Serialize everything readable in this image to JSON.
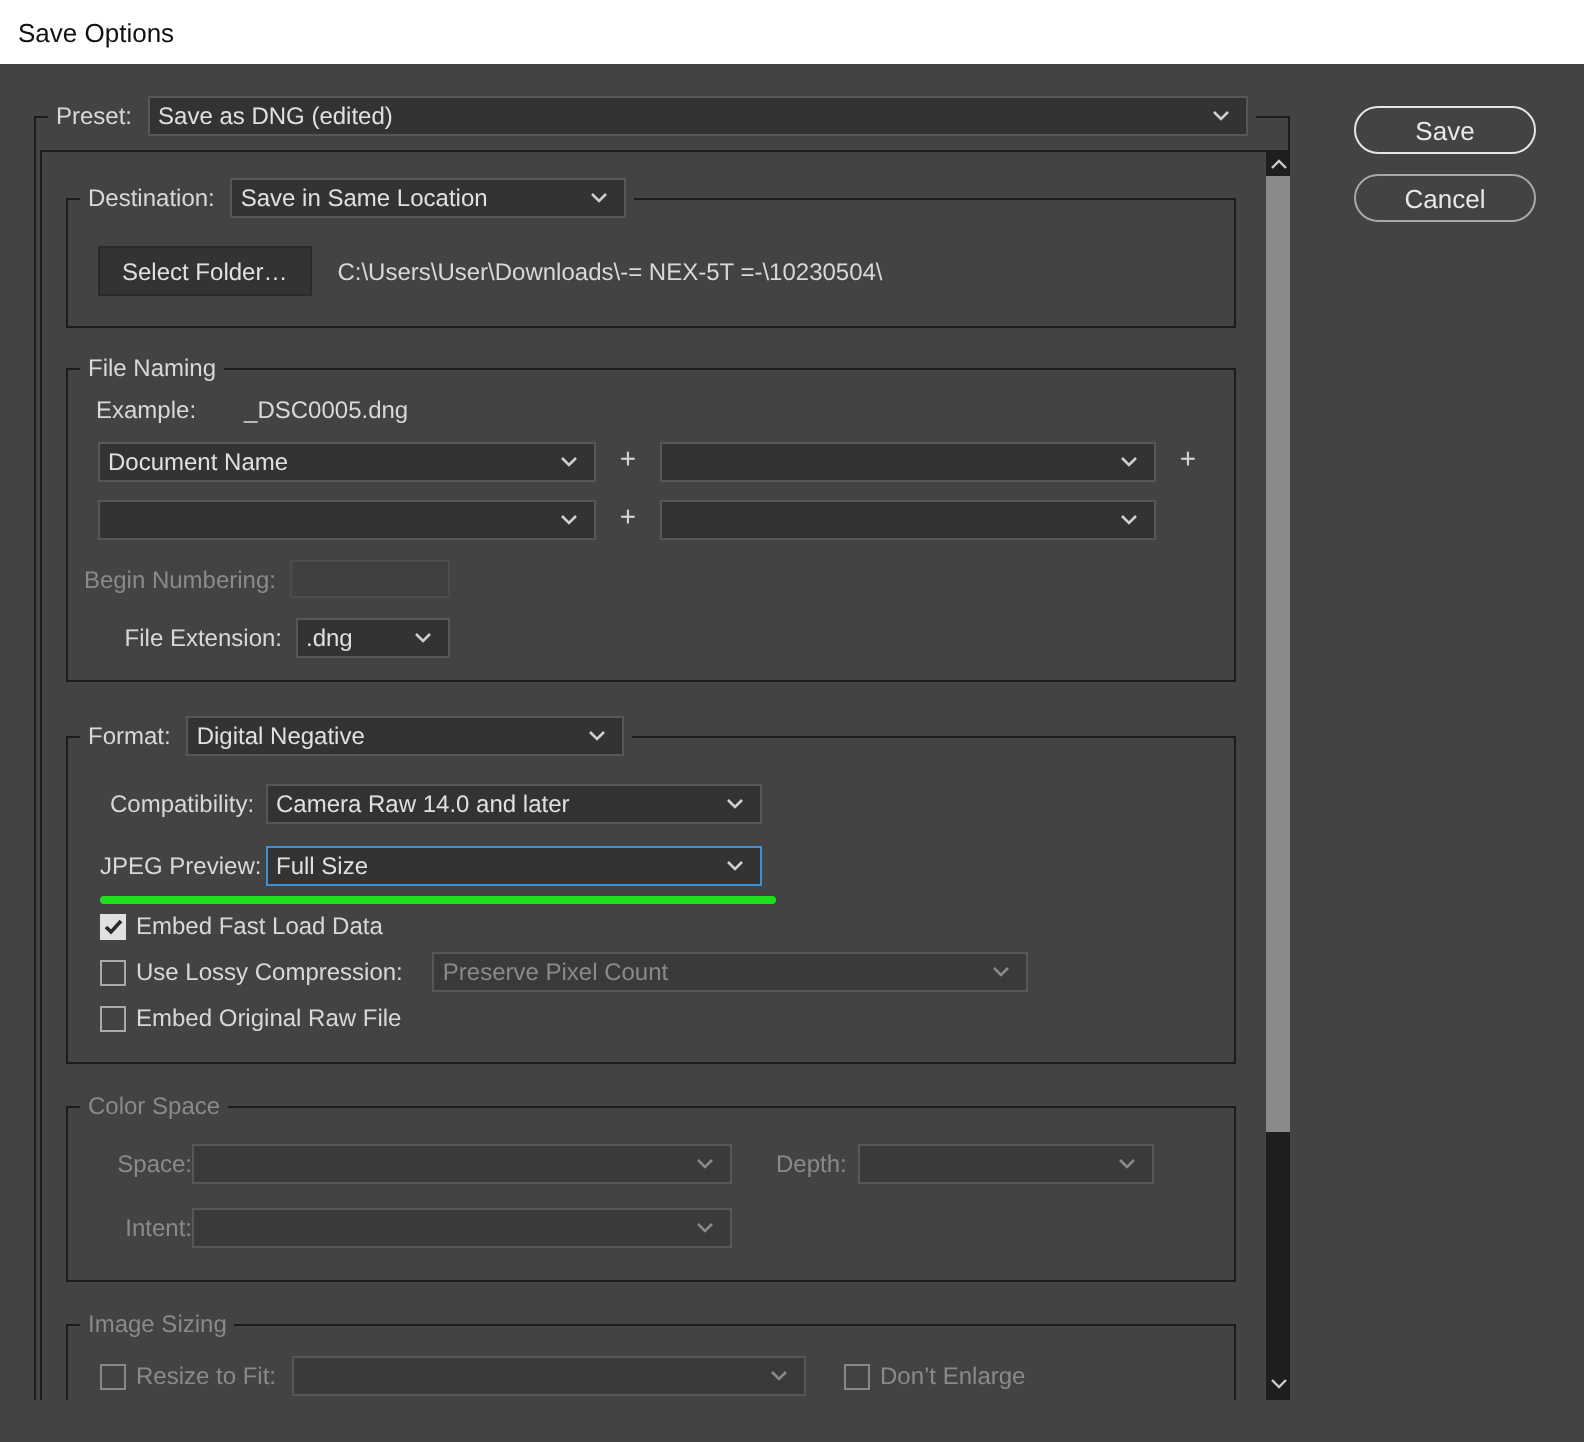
{
  "window": {
    "title": "Save Options"
  },
  "preset": {
    "label": "Preset:",
    "value": "Save as DNG (edited)"
  },
  "destination": {
    "label": "Destination:",
    "value": "Save in Same Location",
    "button": "Select Folder…",
    "path": "C:\\Users\\User\\Downloads\\-= NEX-5T =-\\10230504\\"
  },
  "file_naming": {
    "title": "File Naming",
    "example_label": "Example:",
    "example": "_DSC0005.dng",
    "fields": [
      {
        "kind": "dropdown",
        "value": "Document Name",
        "plus": "+"
      },
      {
        "kind": "dropdown",
        "plus": "+"
      },
      {
        "kind": "dropdown",
        "plus": "+"
      },
      {
        "kind": "dropdown"
      }
    ],
    "begin_numbering": {
      "label": "Begin Numbering:",
      "disabled": true
    },
    "file_extension": {
      "label": "File Extension:",
      "value": ".dng"
    }
  },
  "format": {
    "label": "Format:",
    "value": "Digital Negative",
    "compatibility": {
      "label": "Compatibility:",
      "value": "Camera Raw 14.0 and later"
    },
    "jpeg_preview": {
      "label": "JPEG Preview:",
      "value": "Full Size",
      "focused": true
    },
    "options": [
      {
        "label": "Embed Fast Load Data",
        "checked": true
      },
      {
        "label": "Use Lossy Compression:",
        "checked": false,
        "select": {
          "value": "Preserve Pixel Count",
          "disabled": true
        }
      },
      {
        "label": "Embed Original Raw File",
        "checked": false
      }
    ]
  },
  "color_space": {
    "title": "Color Space",
    "disabled": true,
    "space": {
      "label": "Space:"
    },
    "depth": {
      "label": "Depth:"
    },
    "intent": {
      "label": "Intent:"
    }
  },
  "image_sizing": {
    "title": "Image Sizing",
    "disabled": true,
    "resize": {
      "label": "Resize to Fit:",
      "checked": false
    },
    "dont_enlarge": {
      "label": "Don’t Enlarge",
      "checked": false
    }
  },
  "buttons": [
    {
      "label": "Save",
      "kind": "primary"
    },
    {
      "label": "Cancel",
      "kind": "secondary"
    }
  ]
}
